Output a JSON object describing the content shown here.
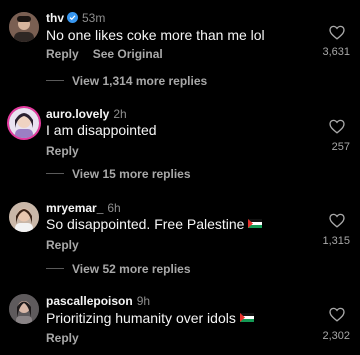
{
  "comments": [
    {
      "username": "thv",
      "verified": true,
      "time": "53m",
      "text": "No one likes coke more than me lol",
      "actions": [
        "Reply",
        "See Original"
      ],
      "likes": "3,631",
      "view_replies": "View 1,314 more replies"
    },
    {
      "username": "auro.lovely",
      "time": "2h",
      "text": "I am disappointed",
      "actions": [
        "Reply"
      ],
      "likes": "257",
      "view_replies": "View 15 more replies"
    },
    {
      "username": "mryemar_",
      "time": "6h",
      "text": "So disappointed. Free Palestine",
      "flag": "palestine-flag",
      "actions": [
        "Reply"
      ],
      "likes": "1,315",
      "view_replies": "View 52 more replies"
    },
    {
      "username": "pascallepoison",
      "time": "9h",
      "text": "Prioritizing humanity over idols",
      "flag": "palestine-flag",
      "actions": [
        "Reply"
      ],
      "likes": "2,302"
    }
  ],
  "colors": {
    "background": "#000000",
    "primary_text": "#f5f5f5",
    "secondary_text": "#a8a8a8",
    "verified_badge": "#3897f0",
    "story_ring": "#e63aa0"
  }
}
